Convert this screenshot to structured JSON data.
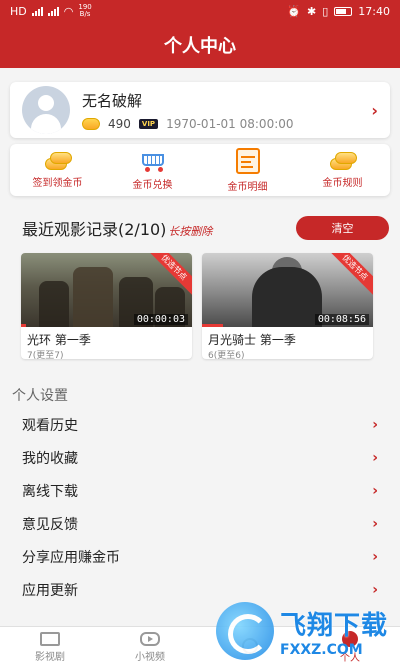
{
  "status_bar": {
    "left_label": "HD",
    "network_speed": "190",
    "network_unit": "B/s",
    "time": "17:40"
  },
  "header": {
    "title": "个人中心"
  },
  "profile": {
    "name": "无名破解",
    "coins": "490",
    "vip_label": "VIP",
    "date": "1970-01-01 08:00:00"
  },
  "shortcuts": [
    {
      "label": "签到领金币",
      "icon": "coins-icon"
    },
    {
      "label": "金币兑换",
      "icon": "cart-icon"
    },
    {
      "label": "金币明细",
      "icon": "bill-icon"
    },
    {
      "label": "金币规则",
      "icon": "coins-icon"
    }
  ],
  "history": {
    "title": "最近观影记录(2/10)",
    "hint": "长按删除",
    "clear_label": "清空",
    "items": [
      {
        "title": "光环 第一季",
        "subtitle": "7(更至7)",
        "duration": "00:00:03",
        "badge": "优选节点",
        "progress": 0.03
      },
      {
        "title": "月光骑士 第一季",
        "subtitle": "6(更至6)",
        "duration": "00:08:56",
        "badge": "优选节点",
        "progress": 0.12
      }
    ]
  },
  "settings": {
    "title": "个人设置",
    "items": [
      "观看历史",
      "我的收藏",
      "离线下载",
      "意见反馈",
      "分享应用赚金币",
      "应用更新"
    ]
  },
  "tabbar": [
    {
      "label": "影视剧",
      "active": false
    },
    {
      "label": "小视频",
      "active": false
    },
    {
      "label": "",
      "active": false
    },
    {
      "label": "个人",
      "active": true
    }
  ],
  "watermark": {
    "cn": "飞翔下载",
    "en": "FXXZ.COM"
  },
  "colors": {
    "primary": "#c62828",
    "background": "#f4f4f4"
  }
}
